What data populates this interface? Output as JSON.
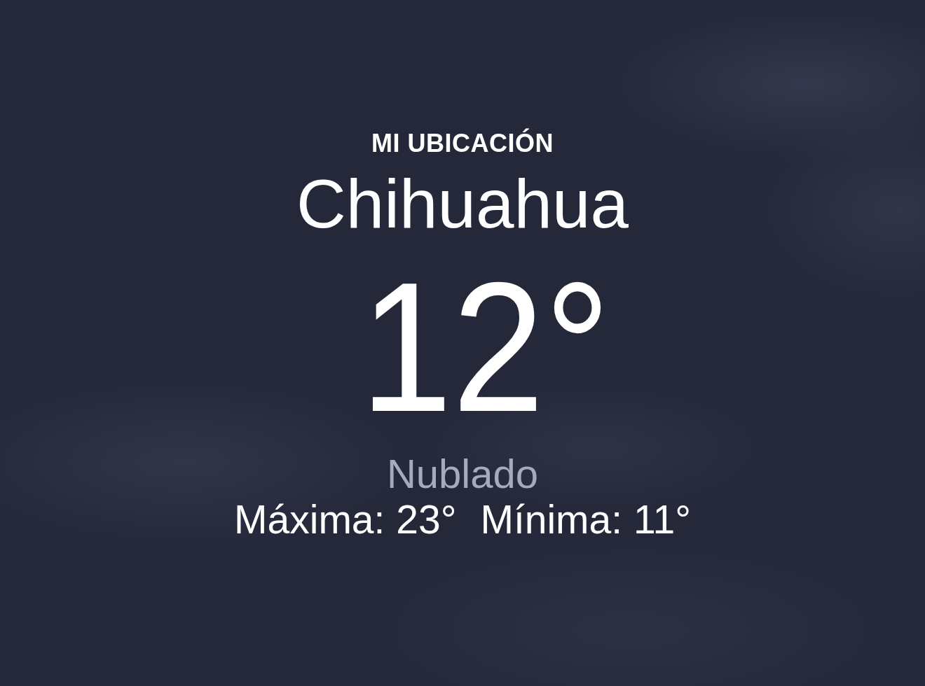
{
  "location_label": "MI UBICACIÓN",
  "city": "Chihuahua",
  "temperature": "12°",
  "condition": "Nublado",
  "high": "Máxima: 23°",
  "low": "Mínima: 11°"
}
